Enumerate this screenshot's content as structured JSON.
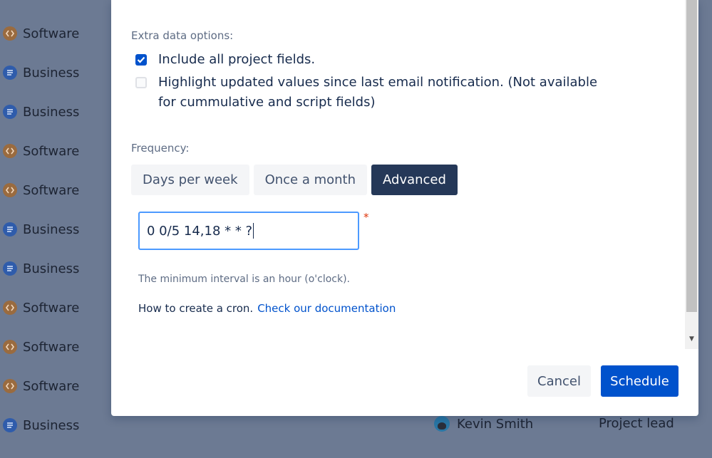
{
  "background": {
    "project_rows": [
      {
        "type": "Software",
        "icon": "code-icon"
      },
      {
        "type": "Business",
        "icon": "lines-icon"
      },
      {
        "type": "Business",
        "icon": "lines-icon"
      },
      {
        "type": "Software",
        "icon": "code-icon"
      },
      {
        "type": "Software",
        "icon": "code-icon"
      },
      {
        "type": "Business",
        "icon": "lines-icon"
      },
      {
        "type": "Business",
        "icon": "lines-icon"
      },
      {
        "type": "Software",
        "icon": "code-icon"
      },
      {
        "type": "Software",
        "icon": "code-icon"
      },
      {
        "type": "Software",
        "icon": "code-icon"
      },
      {
        "type": "Business",
        "icon": "lines-icon"
      }
    ],
    "lead_name": "Kevin Smith",
    "lead_role": "Project lead"
  },
  "modal": {
    "extra_options_label": "Extra data options:",
    "include_fields": {
      "label": "Include all project fields.",
      "checked": true
    },
    "highlight_updates": {
      "label": "Highlight updated values since last email notification. (Not available for cummulative and script fields)",
      "checked": false
    },
    "frequency_label": "Frequency:",
    "frequency_tabs": [
      {
        "label": "Days per week",
        "active": false
      },
      {
        "label": "Once a month",
        "active": false
      },
      {
        "label": "Advanced",
        "active": true
      }
    ],
    "cron_value": "0 0/5 14,18 * * ?",
    "required_marker": "*",
    "hint": "The minimum interval is an hour (o'clock).",
    "howto_text": "How to create a cron.",
    "doc_link": "Check our documentation",
    "cancel_label": "Cancel",
    "schedule_label": "Schedule"
  },
  "colors": {
    "primary": "#0052cc",
    "active_tab": "#253858",
    "overlay": "#6c7a93",
    "focus_border": "#4c9aff",
    "required": "#de350b"
  }
}
